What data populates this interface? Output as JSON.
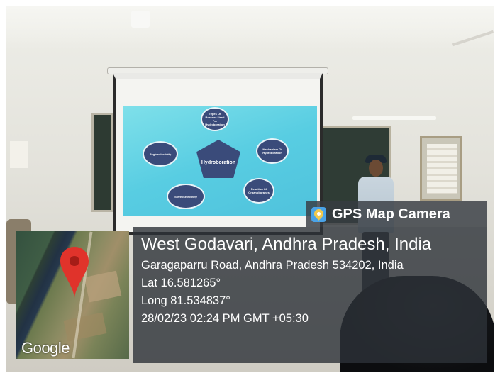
{
  "slide": {
    "center_title": "Hydroboration",
    "bubbles": [
      "Types Of Boranes Used For Hydroboration",
      "Regioselectivity",
      "Mechanism Of Hydroboration",
      "Reaction Of Organoboranes",
      "Stereoselectivity"
    ]
  },
  "overlay": {
    "app_name": "GPS Map Camera",
    "location_title": "West Godavari, Andhra Pradesh, India",
    "address": "Garagaparru Road, Andhra Pradesh 534202, India",
    "latitude": "Lat 16.581265°",
    "longitude": "Long 81.534837°",
    "timestamp": "28/02/23 02:24 PM GMT +05:30",
    "map_logo": "Google"
  },
  "colors": {
    "pin": "#e0332b",
    "slide_background": "#58cde2",
    "bubble": "#3a4b7a"
  }
}
